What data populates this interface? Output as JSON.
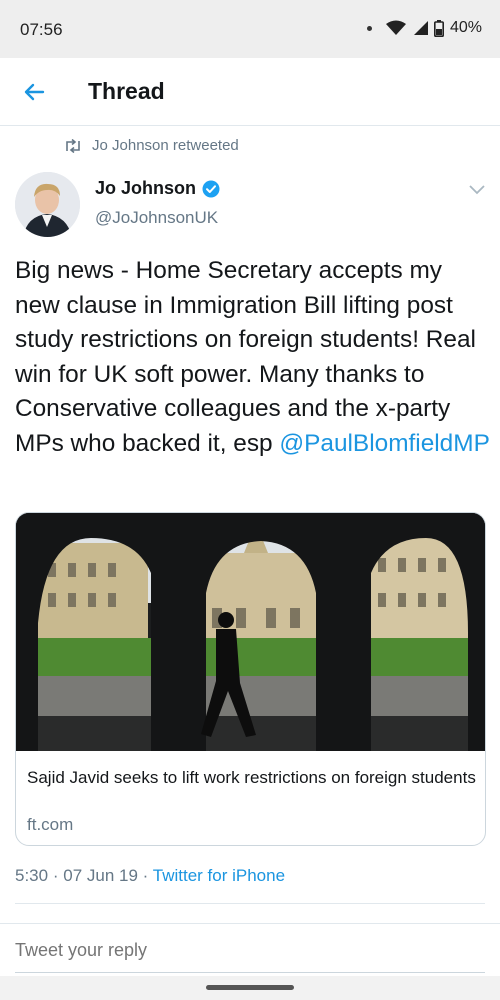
{
  "status_bar": {
    "time": "07:56",
    "battery": "40%",
    "icons": [
      "notification-dot-icon",
      "wifi-icon",
      "signal-icon",
      "battery-icon"
    ]
  },
  "app_bar": {
    "title": "Thread",
    "back_icon": "arrow-left-icon"
  },
  "tweet": {
    "retweeted_by": "Jo Johnson retweeted",
    "author_name": "Jo Johnson",
    "author_handle": "@JoJohnsonUK",
    "verified": true,
    "text": "Big news - Home Secretary accepts my new clause in Immigration Bill lifting post study restrictions on foreign students! Real win for UK soft power. Many thanks to Conservative colleagues and the x-party MPs who backed it, esp ",
    "mention": "@PaulBlomfieldMP",
    "card": {
      "title": "Sajid Javid seeks to lift work restrictions on foreign students",
      "domain": "ft.com"
    },
    "time": "5:30",
    "date": "07 Jun 19",
    "separator": "·",
    "source": "Twitter for iPhone"
  },
  "reply": {
    "placeholder": "Tweet your reply"
  },
  "colors": {
    "accent": "#1b95e0",
    "secondary_text": "#657786",
    "primary_text": "#14171a",
    "border": "#e1e8ed"
  }
}
